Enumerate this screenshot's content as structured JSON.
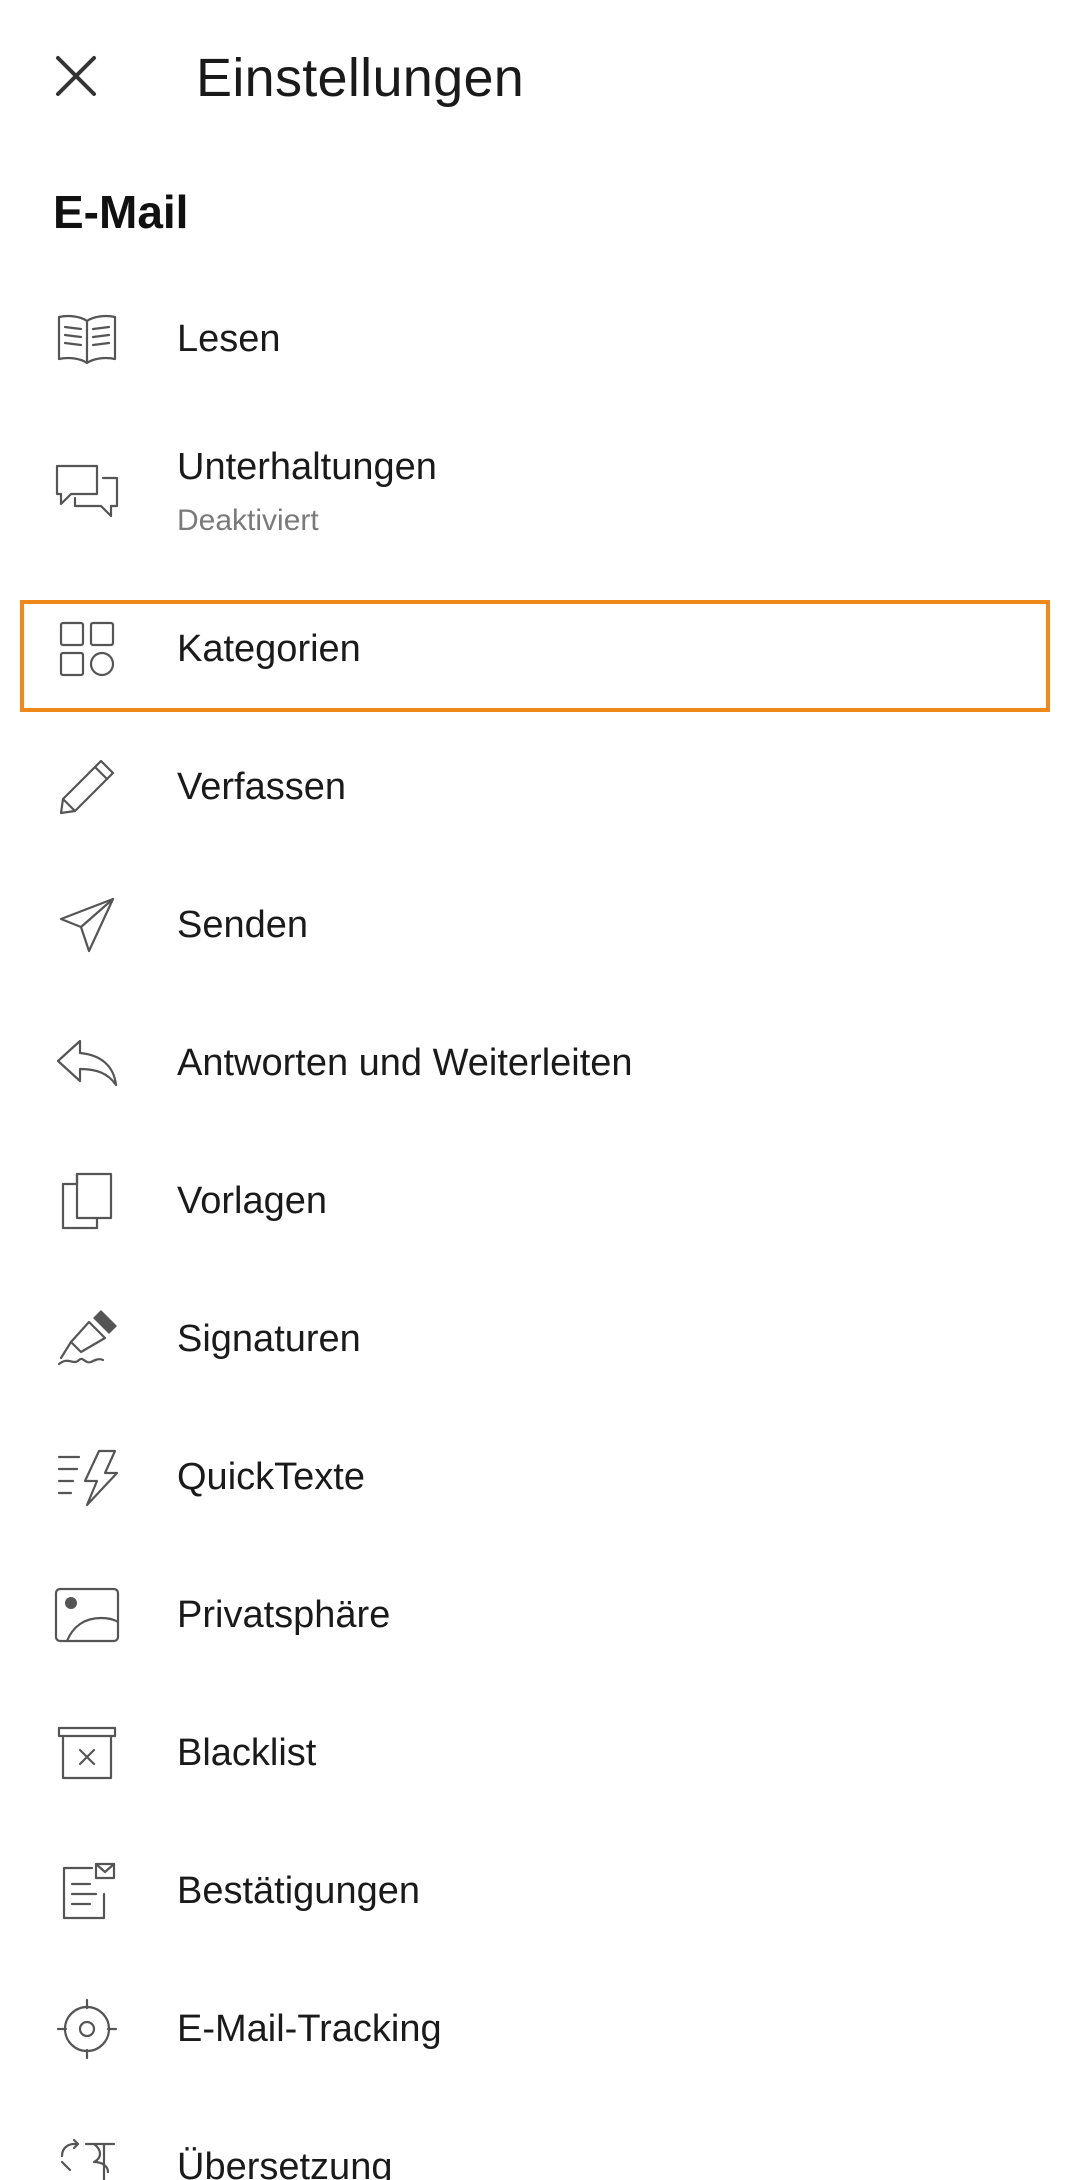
{
  "header": {
    "title": "Einstellungen",
    "close_icon": "close-icon"
  },
  "section": {
    "title": "E-Mail"
  },
  "items": [
    {
      "label": "Lesen",
      "icon": "book-open-icon"
    },
    {
      "label": "Unterhaltungen",
      "sublabel": "Deaktiviert",
      "icon": "chat-bubbles-icon"
    },
    {
      "label": "Kategorien",
      "icon": "categories-icon",
      "selected": true
    },
    {
      "label": "Verfassen",
      "icon": "pencil-icon"
    },
    {
      "label": "Senden",
      "icon": "send-icon"
    },
    {
      "label": "Antworten und Weiterleiten",
      "icon": "reply-icon"
    },
    {
      "label": "Vorlagen",
      "icon": "templates-icon"
    },
    {
      "label": "Signaturen",
      "icon": "signature-pen-icon"
    },
    {
      "label": "QuickTexte",
      "icon": "quicktext-icon"
    },
    {
      "label": "Privatsphäre",
      "icon": "image-privacy-icon"
    },
    {
      "label": "Blacklist",
      "icon": "archive-block-icon"
    },
    {
      "label": "Bestätigungen",
      "icon": "receipt-mail-icon"
    },
    {
      "label": "E-Mail-Tracking",
      "icon": "target-icon"
    },
    {
      "label": "Übersetzung",
      "icon": "translate-icon"
    }
  ],
  "colors": {
    "accent": "#ef8a1a",
    "text": "#1a1a1a",
    "subtext": "#7a7a7a",
    "icon": "#555555",
    "background": "#ffffff"
  }
}
